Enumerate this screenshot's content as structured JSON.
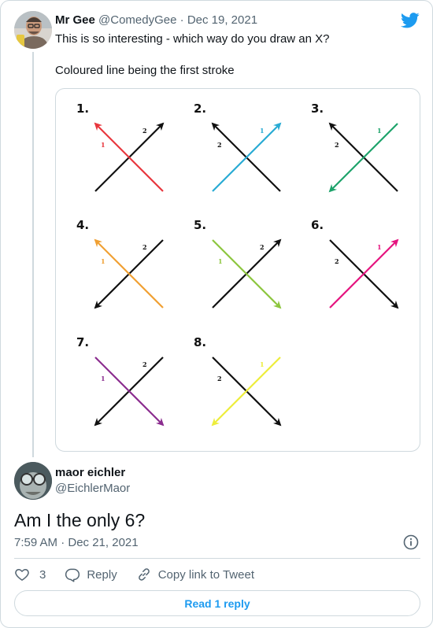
{
  "tweet": {
    "author_name": "Mr Gee",
    "handle": "@ComedyGee",
    "separator": "·",
    "date": "Dec 19, 2021",
    "text_line1": "This is so interesting - which way do you draw an X?",
    "text_line2": "Coloured line being the first stroke",
    "bird_icon": "twitter-bird-icon"
  },
  "figure": {
    "panels": [
      {
        "number": "1.",
        "color": "#e8363d",
        "first": "1",
        "second": "2"
      },
      {
        "number": "2.",
        "color": "#29abd4",
        "first": "1",
        "second": "2"
      },
      {
        "number": "3.",
        "color": "#1ea36b",
        "first": "1",
        "second": "2"
      },
      {
        "number": "4.",
        "color": "#f0a033",
        "first": "1",
        "second": "2"
      },
      {
        "number": "5.",
        "color": "#8dc63f",
        "first": "1",
        "second": "2"
      },
      {
        "number": "6.",
        "color": "#e5147f",
        "first": "1",
        "second": "2"
      },
      {
        "number": "7.",
        "color": "#8b2d8f",
        "first": "1",
        "second": "2"
      },
      {
        "number": "8.",
        "color": "#eded3c",
        "first": "1",
        "second": "2"
      }
    ]
  },
  "reply": {
    "author_name": "maor eichler",
    "handle": "@EichlerMaor",
    "text": "Am I the only 6?",
    "timestamp": "7:59 AM · Dec 21, 2021"
  },
  "actions": {
    "like_count": "3",
    "reply_label": "Reply",
    "copy_label": "Copy link to Tweet"
  },
  "read_button": "Read 1 reply",
  "colors": {
    "accent": "#1d9bf0",
    "text": "#0f1419",
    "muted": "#536471",
    "border": "#cfd9de"
  }
}
